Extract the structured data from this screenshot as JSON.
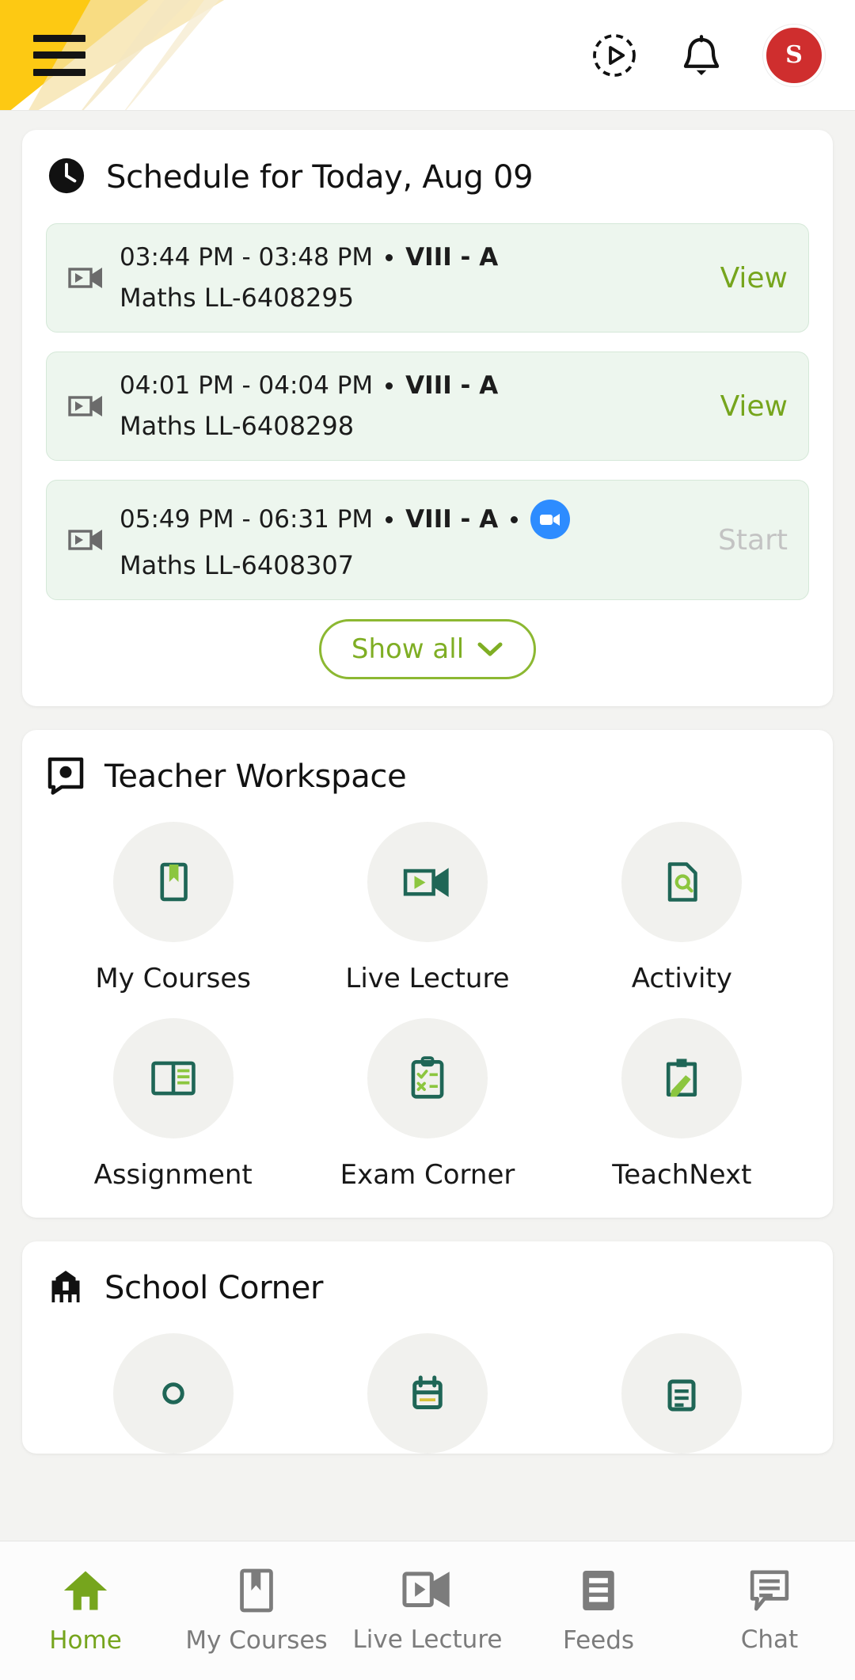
{
  "header": {
    "menu_icon": "hamburger-menu-icon",
    "play_icon": "play-circle-dashed-icon",
    "bell_icon": "notification-bell-icon",
    "avatar_initial": "S",
    "avatar_color": "#cf2e2e"
  },
  "schedule": {
    "icon": "clock-icon",
    "title": "Schedule for Today, Aug 09",
    "rows": [
      {
        "icon": "video-camera-icon",
        "time": "03:44 PM - 03:48 PM",
        "grade": "VIII - A",
        "subject": "Maths LL-6408295",
        "action": "View",
        "action_state": "active",
        "has_zoom": false
      },
      {
        "icon": "video-camera-icon",
        "time": "04:01 PM - 04:04 PM",
        "grade": "VIII - A",
        "subject": "Maths LL-6408298",
        "action": "View",
        "action_state": "active",
        "has_zoom": false
      },
      {
        "icon": "video-camera-icon",
        "time": "05:49 PM - 06:31 PM",
        "grade": "VIII - A",
        "subject": "Maths LL-6408307",
        "action": "Start",
        "action_state": "disabled",
        "has_zoom": true,
        "zoom_icon": "zoom-meeting-icon"
      }
    ],
    "show_all_label": "Show all",
    "show_all_icon": "chevron-down-icon"
  },
  "workspace": {
    "icon": "workspace-board-icon",
    "title": "Teacher Workspace",
    "tiles": [
      {
        "label": "My Courses",
        "icon": "book-bookmark-icon"
      },
      {
        "label": "Live Lecture",
        "icon": "video-camera-icon"
      },
      {
        "label": "Activity",
        "icon": "document-search-icon"
      },
      {
        "label": "Assignment",
        "icon": "book-open-lines-icon"
      },
      {
        "label": "Exam Corner",
        "icon": "clipboard-check-cross-icon"
      },
      {
        "label": "TeachNext",
        "icon": "clipboard-pen-icon"
      }
    ]
  },
  "school_corner": {
    "icon": "school-building-icon",
    "title": "School Corner",
    "tiles": [
      {
        "label": "",
        "icon": "circle-outline-icon"
      },
      {
        "label": "",
        "icon": "calendar-icon"
      },
      {
        "label": "",
        "icon": "news-document-icon"
      }
    ]
  },
  "bottom_nav": {
    "items": [
      {
        "label": "Home",
        "icon": "home-icon",
        "active": true
      },
      {
        "label": "My Courses",
        "icon": "book-bookmark-icon",
        "active": false
      },
      {
        "label": "Live Lecture",
        "icon": "video-camera-icon",
        "active": false
      },
      {
        "label": "Feeds",
        "icon": "feeds-list-icon",
        "active": false
      },
      {
        "label": "Chat",
        "icon": "chat-bubble-icon",
        "active": false
      }
    ]
  },
  "colors": {
    "accent_green": "#76a51d",
    "icon_teal": "#1f6656",
    "icon_lime": "#8cc63f",
    "slot_bg": "#edf6ee",
    "avatar_red": "#cf2e2e",
    "zoom_blue": "#2d8cff",
    "deco_yellow": "#ffd21e"
  }
}
